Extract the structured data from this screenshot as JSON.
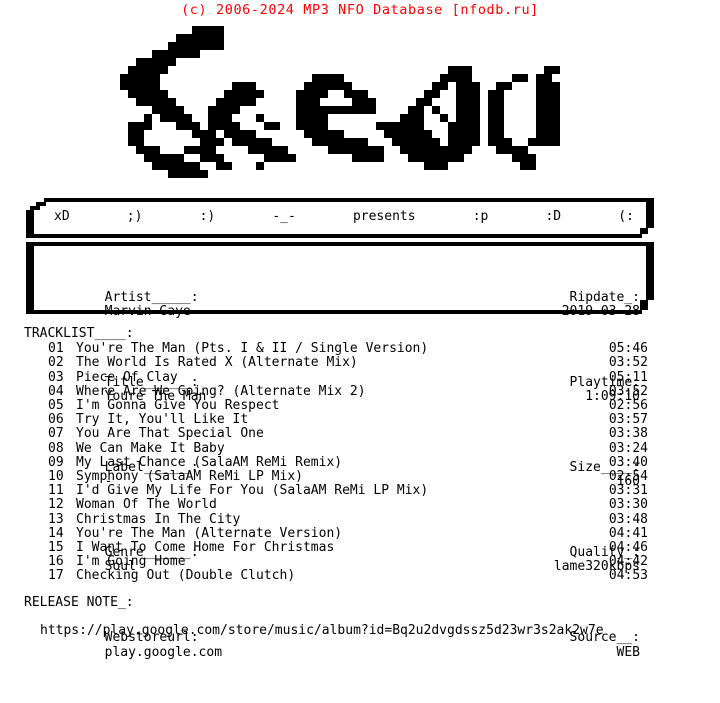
{
  "header": {
    "copyright": "(c) 2006-2024 MP3 NFO Database [nfodb.ru]",
    "color": "#ff0000"
  },
  "logo": {
    "text": "Sceau",
    "style": "pixel-graffiti-ascii-art",
    "color": "#000000"
  },
  "presents_bar": {
    "faces_left": [
      "xD",
      ";)",
      ":)",
      "-_-"
    ],
    "center_label": "presents",
    "faces_right": [
      ":p",
      ":D",
      "(:"
    ],
    "items": [
      "xD",
      ";)",
      ":)",
      "-_-",
      "presents",
      ":p",
      ":D",
      "(:"
    ]
  },
  "info": {
    "left": [
      {
        "label": "Artist_____:",
        "value": "Marvin Gaye"
      },
      {
        "label": "Title______:",
        "value": "Youre The Man"
      },
      {
        "label": "Label______:",
        "value": "-"
      },
      {
        "label": "Genre______:",
        "value": "Soul"
      },
      {
        "label": "Webstoreurl:",
        "value": "play.google.com"
      }
    ],
    "right": [
      {
        "label": "Ripdate_:",
        "value": "2019-03-28"
      },
      {
        "label": "Playtime:",
        "value": "1:09:10"
      },
      {
        "label": "Size____:",
        "value": "160"
      },
      {
        "label": "Quality_:",
        "value": "lame320kbps"
      },
      {
        "label": "Source__:",
        "value": "WEB"
      }
    ]
  },
  "tracklist": {
    "heading": "TRACKLIST____:",
    "tracks": [
      {
        "num": "01",
        "title": "You're The Man (Pts. I & II / Single Version)",
        "time": "05:46"
      },
      {
        "num": "02",
        "title": "The World Is Rated X (Alternate Mix)",
        "time": "03:52"
      },
      {
        "num": "03",
        "title": "Piece Of Clay",
        "time": "05:11"
      },
      {
        "num": "04",
        "title": "Where Are We Going? (Alternate Mix 2)",
        "time": "03:52"
      },
      {
        "num": "05",
        "title": "I'm Gonna Give You Respect",
        "time": "02:56"
      },
      {
        "num": "06",
        "title": "Try It, You'll Like It",
        "time": "03:57"
      },
      {
        "num": "07",
        "title": "You Are That Special One",
        "time": "03:38"
      },
      {
        "num": "08",
        "title": "We Can Make It Baby",
        "time": "03:24"
      },
      {
        "num": "09",
        "title": "My Last Chance (SalaAM ReMi Remix)",
        "time": "03:40"
      },
      {
        "num": "10",
        "title": "Symphony (SalaAM ReMi LP Mix)",
        "time": "02:54"
      },
      {
        "num": "11",
        "title": "I'd Give My Life For You (SalaAM ReMi LP Mix)",
        "time": "03:31"
      },
      {
        "num": "12",
        "title": "Woman Of The World",
        "time": "03:30"
      },
      {
        "num": "13",
        "title": "Christmas In The City",
        "time": "03:48"
      },
      {
        "num": "14",
        "title": "You're The Man (Alternate Version)",
        "time": "04:41"
      },
      {
        "num": "15",
        "title": "I Want To Come Home For Christmas",
        "time": "04:46"
      },
      {
        "num": "16",
        "title": "I'm Going Home",
        "time": "04:42"
      },
      {
        "num": "17",
        "title": "Checking Out (Double Clutch)",
        "time": "04:53"
      }
    ]
  },
  "release_note": {
    "heading": "RELEASE NOTE_:",
    "url": "https://play.google.com/store/music/album?id=Bq2u2dvgdssz5d23wr3s2ak2w7e"
  }
}
